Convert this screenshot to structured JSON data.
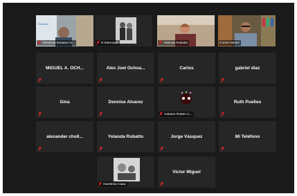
{
  "participants": [
    {
      "name": "Gerencia Essalud Ar...",
      "type": "video"
    },
    {
      "name": "N Manrique",
      "type": "photo"
    },
    {
      "name": "Yolanda Rubatto",
      "type": "video"
    },
    {
      "name": "Coche Núñez",
      "type": "video",
      "active_speaker": true
    },
    {
      "name": "MIGUEL A. OCH...",
      "type": "name"
    },
    {
      "name": "Alex Joel Ochoa...",
      "type": "name"
    },
    {
      "name": "Carlos",
      "type": "name"
    },
    {
      "name": "gabriel diaz",
      "type": "name"
    },
    {
      "name": "Gina",
      "type": "name"
    },
    {
      "name": "Dennise Alvarez",
      "type": "name"
    },
    {
      "name": "Adriano Ruben C...",
      "type": "avatar"
    },
    {
      "name": "Ruth Puelles",
      "type": "name"
    },
    {
      "name": "alexander chull...",
      "type": "name"
    },
    {
      "name": "Yolanda Rubatto",
      "type": "name"
    },
    {
      "name": "Jorge Vásquez",
      "type": "name"
    },
    {
      "name": "Mi Teléfono",
      "type": "name"
    },
    {
      "name": "Gardenia Capa",
      "type": "photo"
    },
    {
      "name": "Victor Miguel",
      "type": "name"
    }
  ],
  "colors": {
    "active_speaker_border": "#d8e42a",
    "muted_icon": "#e0262a",
    "tile_bg": "#262626",
    "stage_bg": "#1a1a1a"
  }
}
